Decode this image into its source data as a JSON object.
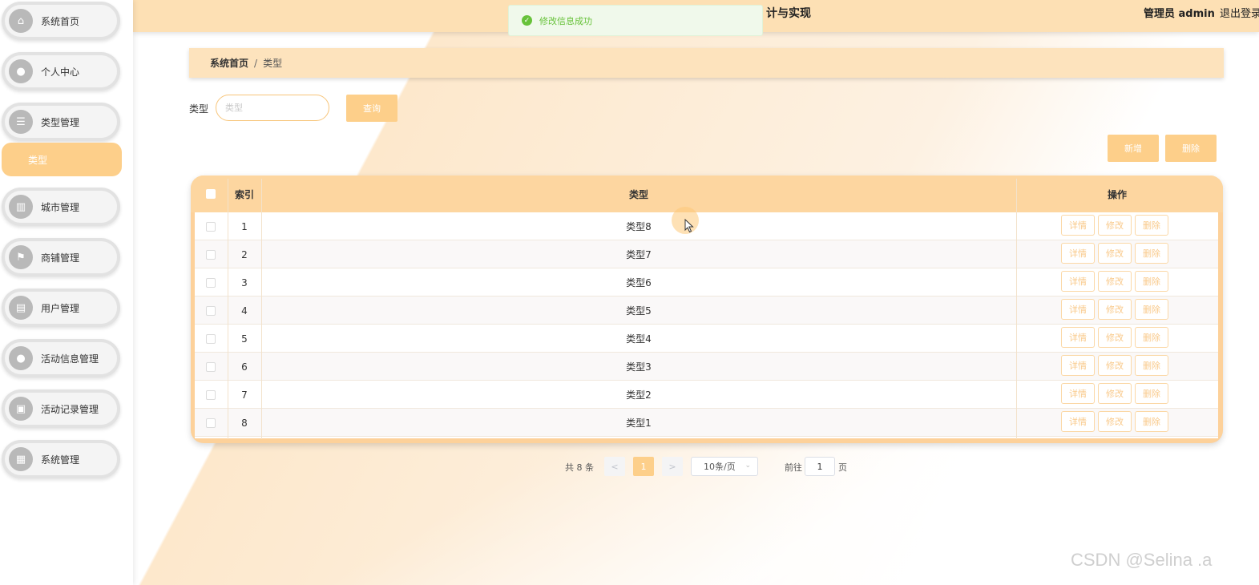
{
  "header": {
    "title_fragment": "计与实现",
    "admin": "管理员 admin",
    "logout": "退出登录"
  },
  "toast": {
    "message": "修改信息成功"
  },
  "sidebar": {
    "items": [
      {
        "label": "系统首页",
        "icon": "home-icon",
        "glyph": "⌂"
      },
      {
        "label": "个人中心",
        "icon": "user-icon",
        "glyph": "●"
      },
      {
        "label": "类型管理",
        "icon": "list-icon",
        "glyph": "☰"
      },
      {
        "label": "城市管理",
        "icon": "map-icon",
        "glyph": "▥"
      },
      {
        "label": "商铺管理",
        "icon": "flag-icon",
        "glyph": "⚑"
      },
      {
        "label": "用户管理",
        "icon": "chat-icon",
        "glyph": "▤"
      },
      {
        "label": "活动信息管理",
        "icon": "person-icon",
        "glyph": "●"
      },
      {
        "label": "活动记录管理",
        "icon": "clipboard-icon",
        "glyph": "▣"
      },
      {
        "label": "系统管理",
        "icon": "grid-icon",
        "glyph": "▦"
      }
    ],
    "submenu": {
      "label": "类型"
    }
  },
  "breadcrumb": {
    "home": "系统首页",
    "separator": "/",
    "current": "类型"
  },
  "search": {
    "label": "类型",
    "placeholder": "类型",
    "value": "",
    "button": "查询"
  },
  "actions": {
    "add": "新增",
    "delete": "删除"
  },
  "table": {
    "headers": {
      "index": "索引",
      "type": "类型",
      "ops": "操作"
    },
    "rows": [
      {
        "index": "1",
        "type": "类型8"
      },
      {
        "index": "2",
        "type": "类型7"
      },
      {
        "index": "3",
        "type": "类型6"
      },
      {
        "index": "4",
        "type": "类型5"
      },
      {
        "index": "5",
        "type": "类型4"
      },
      {
        "index": "6",
        "type": "类型3"
      },
      {
        "index": "7",
        "type": "类型2"
      },
      {
        "index": "8",
        "type": "类型1"
      }
    ],
    "row_actions": {
      "detail": "详情",
      "edit": "修改",
      "delete": "删除"
    }
  },
  "pagination": {
    "total": "共 8 条",
    "prev": "<",
    "current": "1",
    "next": ">",
    "page_size": "10条/页",
    "goto_label": "前往",
    "goto_value": "1",
    "page_suffix": "页"
  },
  "watermark": "CSDN @Selina .a",
  "colors": {
    "accent": "#fdcf8a",
    "header": "#fde0b4",
    "success": "#67c23a"
  }
}
